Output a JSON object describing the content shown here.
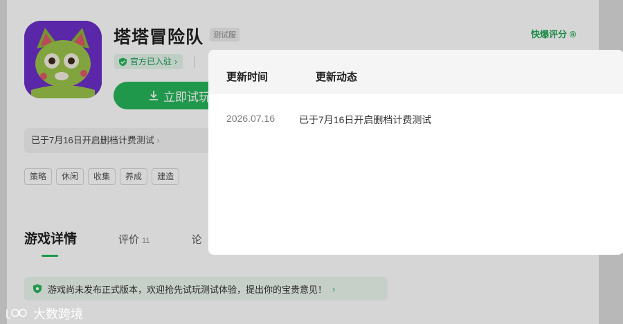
{
  "header": {
    "game_title": "塔塔冒险队",
    "beta_badge": "测试服",
    "official_label": "官方已入驻",
    "play_button": "立即试玩",
    "rating_link": "快爆评分"
  },
  "notice": {
    "text": "已于7月16日开启删档计费测试"
  },
  "tags": [
    "策略",
    "休闲",
    "收集",
    "养成",
    "建造"
  ],
  "tabs": {
    "details": "游戏详情",
    "ratings": "评价",
    "ratings_count": "11",
    "forum": "论"
  },
  "banner": {
    "text": "游戏尚未发布正式版本，欢迎抢先试玩测试体验，提出你的宝贵意见！"
  },
  "modal": {
    "col_time": "更新时间",
    "col_news": "更新动态",
    "rows": [
      {
        "date": "2026.07.16",
        "text": "已于7月16日开启删档计费测试"
      }
    ]
  },
  "watermark": {
    "text": "大数跨境"
  },
  "colors": {
    "accent": "#27b55a",
    "icon_bg": "#6a2fc7"
  }
}
